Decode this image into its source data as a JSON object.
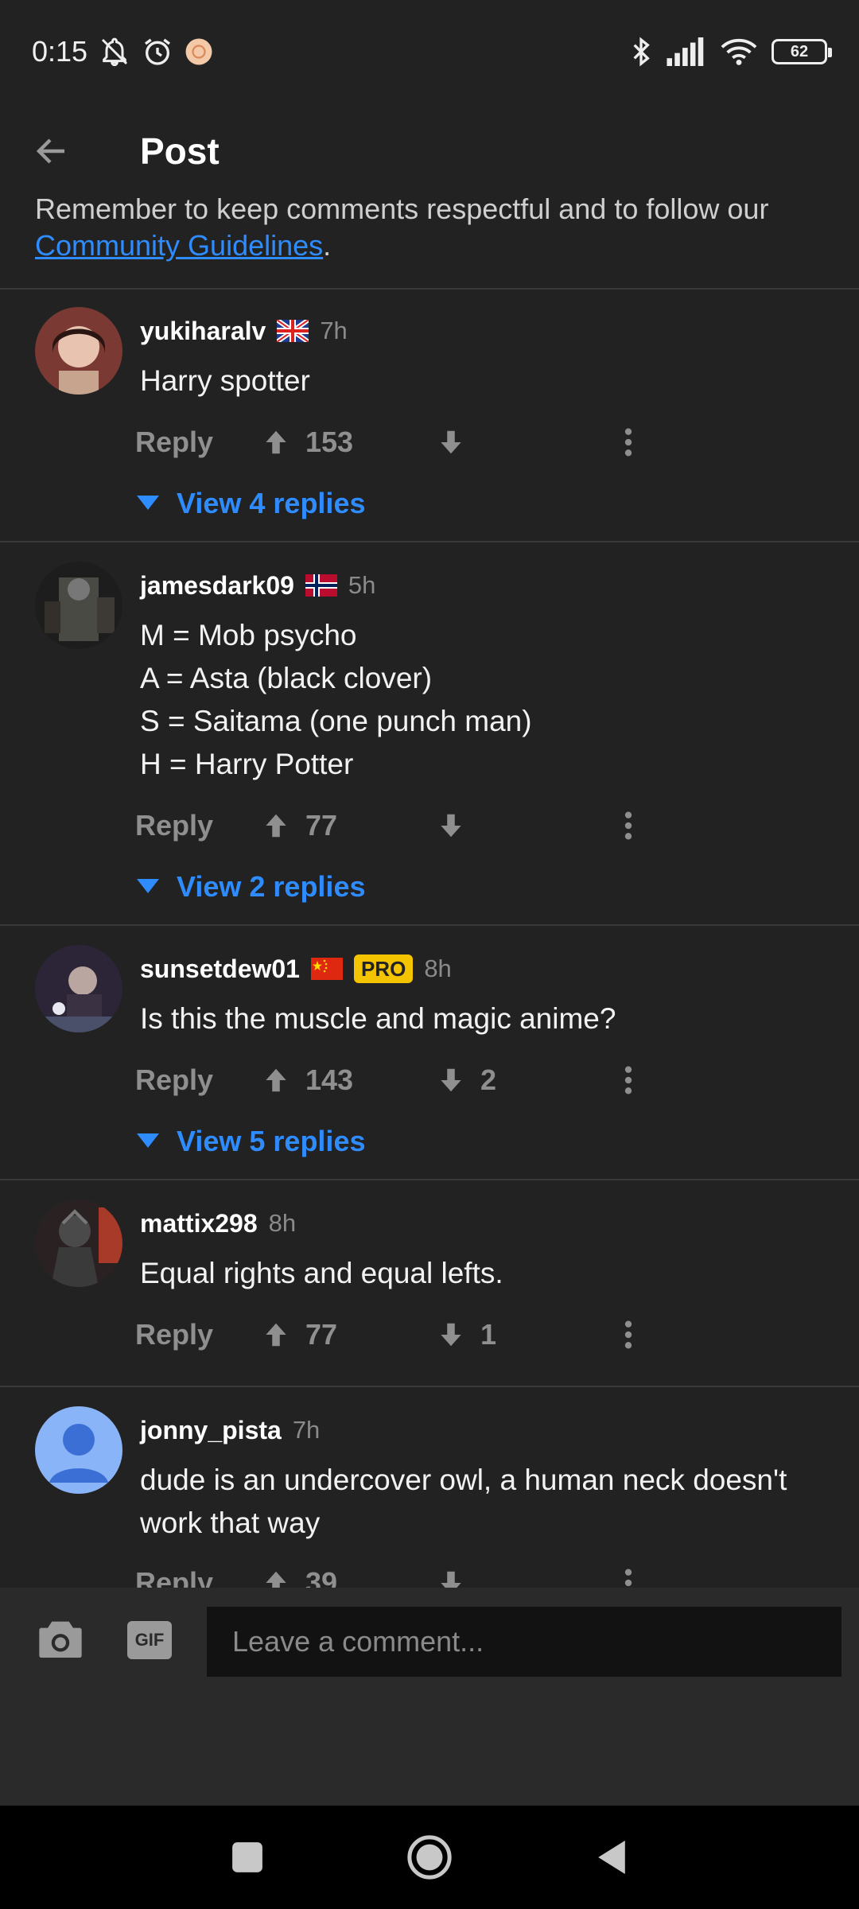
{
  "status_bar": {
    "time": "0:15",
    "battery": "62"
  },
  "header": {
    "title": "Post"
  },
  "guidelines": {
    "text_before": "Remember to keep comments respectful and to follow our ",
    "link_text": "Community Guidelines",
    "text_after": "."
  },
  "comments": [
    {
      "username": "yukiharalv",
      "time": "7h",
      "body": "Harry spotter",
      "reply_label": "Reply",
      "upvotes": "153",
      "downvotes": "",
      "view_replies": "View 4 replies"
    },
    {
      "username": "jamesdark09",
      "time": "5h",
      "lines": [
        "M = Mob psycho",
        "A = Asta (black clover)",
        "S = Saitama (one punch man)",
        "H = Harry Potter"
      ],
      "reply_label": "Reply",
      "upvotes": "77",
      "downvotes": "",
      "view_replies": "View 2 replies"
    },
    {
      "username": "sunsetdew01",
      "badge": "PRO",
      "time": "8h",
      "body": "Is this the muscle and magic anime?",
      "reply_label": "Reply",
      "upvotes": "143",
      "downvotes": "2",
      "view_replies": "View 5 replies"
    },
    {
      "username": "mattix298",
      "time": "8h",
      "body": "Equal rights and equal lefts.",
      "reply_label": "Reply",
      "upvotes": "77",
      "downvotes": "1"
    },
    {
      "username": "jonny_pista",
      "time": "7h",
      "lines": [
        "dude is an undercover owl, a human neck doesn't",
        "work that way"
      ],
      "reply_label": "Reply",
      "upvotes": "39",
      "downvotes": ""
    }
  ],
  "comment_bar": {
    "gif_label": "GIF",
    "placeholder": "Leave a comment..."
  },
  "colors": {
    "background": "#222222",
    "accent": "#2f8cff",
    "pro_badge": "#f5c400",
    "muted": "#8f8f8f"
  },
  "icons": [
    "back-arrow-icon",
    "upvote-arrow-icon",
    "downvote-arrow-icon",
    "more-vert-icon",
    "caret-down-icon",
    "camera-icon",
    "gif-icon",
    "home-square-icon",
    "circle-icon",
    "back-triangle-icon"
  ]
}
